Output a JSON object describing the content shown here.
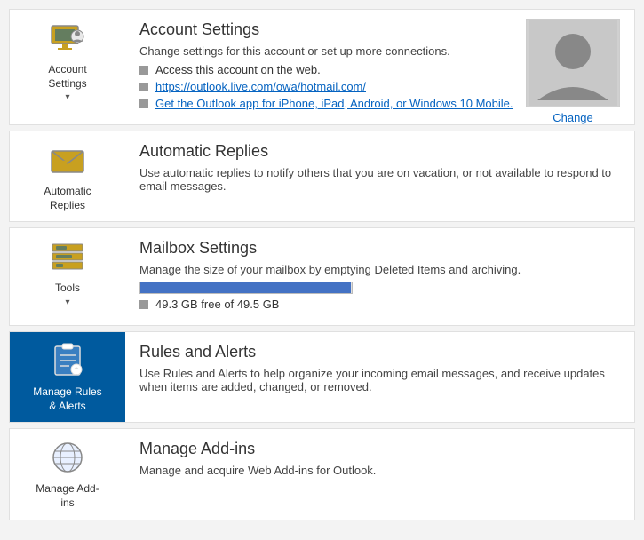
{
  "items": [
    {
      "id": "account-settings",
      "icon": "account",
      "label": "Account\nSettings",
      "hasDropdown": true,
      "active": false,
      "title": "Account Settings",
      "desc": "Change settings for this account or set up more connections.",
      "bullets": [
        {
          "text": "Access this account on the web.",
          "link": null
        },
        {
          "text": "https://outlook.live.com/owa/hotmail.com/",
          "link": "https://outlook.live.com/owa/hotmail.com/"
        },
        {
          "text": "Get the Outlook app for iPhone, iPad, Android, or Windows 10 Mobile.",
          "link": "#"
        }
      ],
      "hasProfile": true,
      "changeLabel": "Change"
    },
    {
      "id": "automatic-replies",
      "icon": "reply",
      "label": "Automatic\nReplies",
      "hasDropdown": false,
      "active": false,
      "title": "Automatic Replies",
      "desc": "Use automatic replies to notify others that you are on vacation, or not available to respond to email messages.",
      "bullets": [],
      "hasProfile": false
    },
    {
      "id": "mailbox-settings",
      "icon": "tools",
      "label": "Tools",
      "hasDropdown": true,
      "active": false,
      "title": "Mailbox Settings",
      "desc": "Manage the size of your mailbox by emptying Deleted Items and archiving.",
      "bullets": [],
      "hasProfile": false,
      "hasProgress": true,
      "progressPercent": 99.6,
      "progressLabel": "49.3 GB free of 49.5 GB"
    },
    {
      "id": "rules-alerts",
      "icon": "rules",
      "label": "Manage Rules\n& Alerts",
      "hasDropdown": false,
      "active": true,
      "title": "Rules and Alerts",
      "desc": "Use Rules and Alerts to help organize your incoming email messages, and receive updates when items are added, changed, or removed.",
      "bullets": [],
      "hasProfile": false
    },
    {
      "id": "manage-addins",
      "icon": "addins",
      "label": "Manage Add-\nins",
      "hasDropdown": false,
      "active": false,
      "title": "Manage Add-ins",
      "desc": "Manage and acquire Web Add-ins for Outlook.",
      "bullets": [],
      "hasProfile": false
    }
  ]
}
